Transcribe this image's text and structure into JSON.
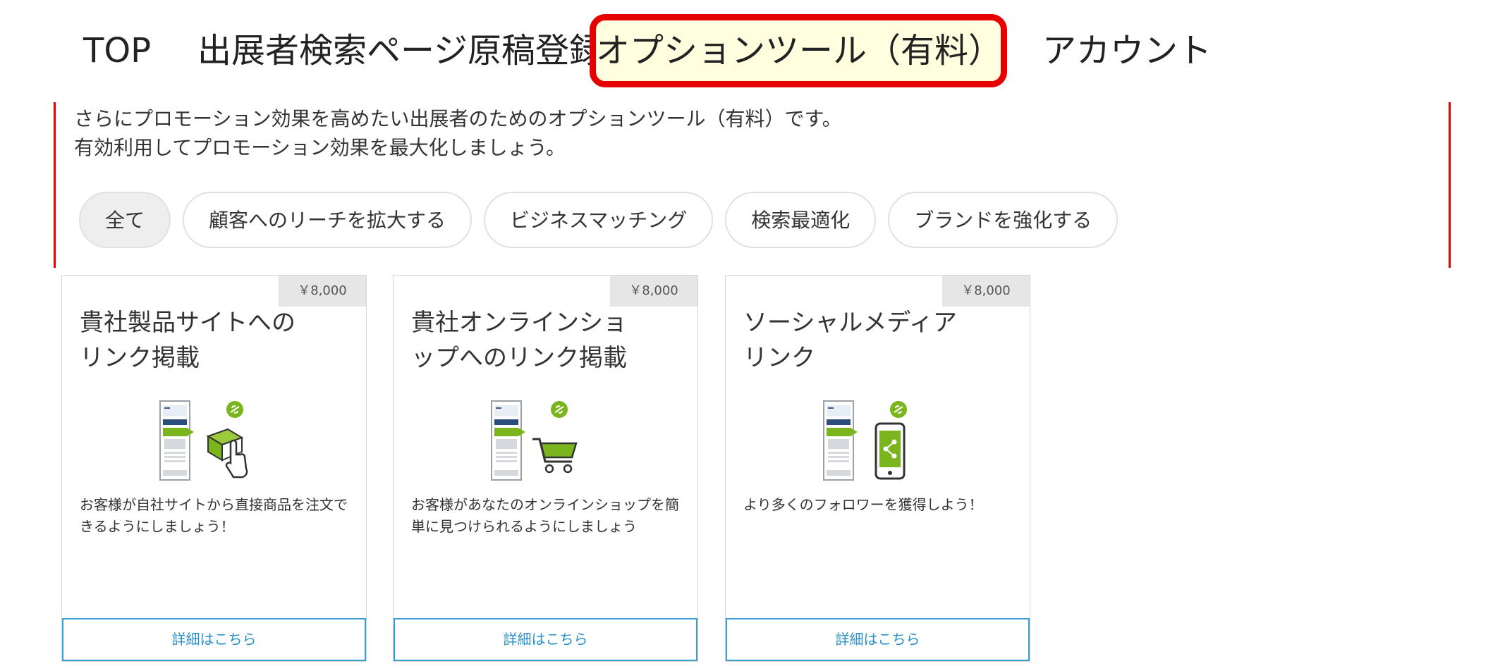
{
  "nav": {
    "tabs": [
      "TOP",
      "出展者検索ページ原稿登録",
      "オプションツール（有料）",
      "アカウント"
    ]
  },
  "intro": {
    "line1": "さらにプロモーション効果を高めたい出展者のためのオプションツール（有料）です。",
    "line2": "有効利用してプロモーション効果を最大化しましょう。"
  },
  "filters": [
    "全て",
    "顧客へのリーチを拡大する",
    "ビジネスマッチング",
    "検索最適化",
    "ブランドを強化する"
  ],
  "cards": [
    {
      "price": "￥8,000",
      "title_line1": "貴社製品サイトへの",
      "title_line2": "リンク掲載",
      "illustration": "box-with-hand-icon",
      "desc": "お客様が自社サイトから直接商品を注文できるようにしましょう！",
      "button": "詳細はこちら"
    },
    {
      "price": "￥8,000",
      "title_line1": "貴社オンラインショ",
      "title_line2": "ップへのリンク掲載",
      "illustration": "shopping-cart-icon",
      "desc": "お客様があなたのオンラインショップを簡単に見つけられるようにしましょう",
      "button": "詳細はこちら"
    },
    {
      "price": "￥8,000",
      "title_line1": "ソーシャルメディア",
      "title_line2": "リンク",
      "illustration": "smartphone-share-icon",
      "desc": "より多くのフォロワーを獲得しよう！",
      "button": "詳細はこちら"
    }
  ],
  "colors": {
    "highlight_border": "#e60000",
    "highlight_bg": "#ffffe0",
    "accent_green": "#7ab51d",
    "button_blue": "#3aa0d0"
  }
}
